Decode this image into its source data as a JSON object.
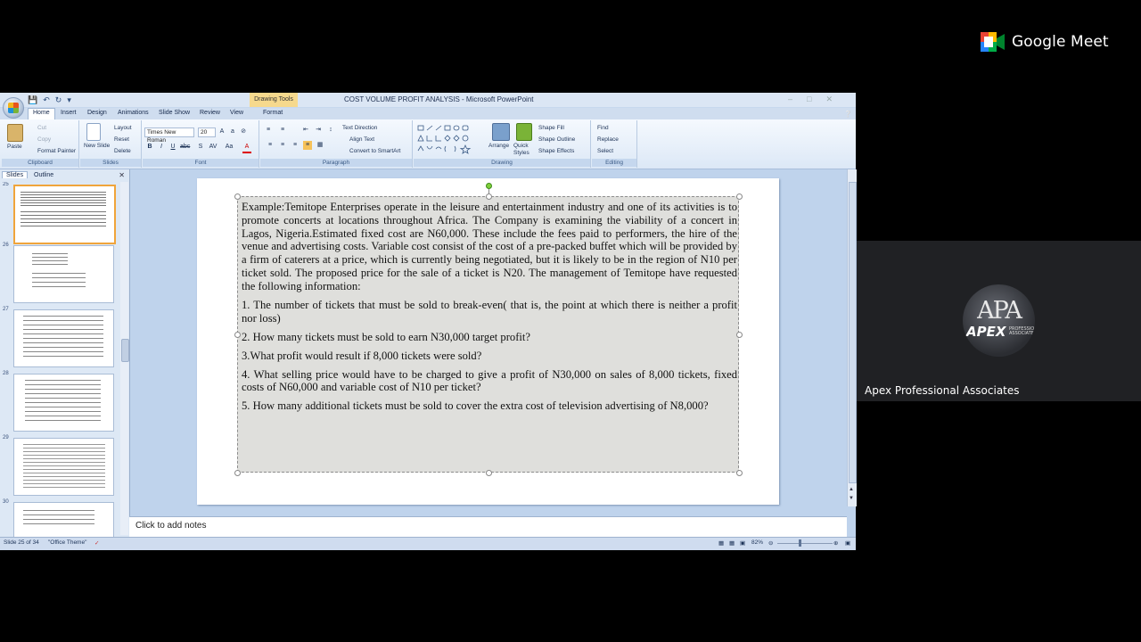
{
  "meet": {
    "brand": "Google Meet",
    "participant_name": "Apex Professional Associates",
    "avatar_initials": "APA",
    "avatar_word": "APEX",
    "avatar_sub": "PROFESSIONAL ASSOCIATES"
  },
  "ppt": {
    "window_title": "COST VOLUME PROFIT ANALYSIS - Microsoft PowerPoint",
    "context_tab": "Drawing Tools",
    "tabs": [
      "Home",
      "Insert",
      "Design",
      "Animations",
      "Slide Show",
      "Review",
      "View",
      "Format"
    ],
    "ribbon": {
      "clipboard": {
        "label": "Clipboard",
        "paste": "Paste",
        "cut": "Cut",
        "copy": "Copy",
        "format_painter": "Format Painter"
      },
      "slides": {
        "label": "Slides",
        "new_slide": "New Slide",
        "layout": "Layout",
        "reset": "Reset",
        "delete": "Delete"
      },
      "font": {
        "label": "Font",
        "family": "Times New Roman",
        "size": "20"
      },
      "paragraph": {
        "label": "Paragraph",
        "text_direction": "Text Direction",
        "align_text": "Align Text",
        "convert": "Convert to SmartArt"
      },
      "drawing": {
        "label": "Drawing",
        "arrange": "Arrange",
        "quick_styles": "Quick Styles",
        "shape_fill": "Shape Fill",
        "shape_outline": "Shape Outline",
        "shape_effects": "Shape Effects"
      },
      "editing": {
        "label": "Editing",
        "find": "Find",
        "replace": "Replace",
        "select": "Select"
      }
    },
    "panel_tabs": {
      "slides": "Slides",
      "outline": "Outline"
    },
    "thumb_numbers": [
      "25",
      "26",
      "27",
      "28",
      "29",
      "30"
    ],
    "slide_paragraphs": [
      "Example:Temitope Enterprises operate in the leisure and entertainment industry and one of its activities is to promote concerts at locations throughout Africa. The Company is examining the viability of a concert in Lagos, Nigeria.Estimated fixed cost are N60,000. These include the fees paid to performers, the hire of the venue and advertising costs. Variable cost consist of the cost of a pre-packed buffet which will be provided by a firm of caterers at a price, which is currently being negotiated, but it is likely to be in the region of N10 per ticket sold. The proposed price for the sale of a ticket is N20. The management of Temitope have requested the following information:",
      "1. The number of tickets that must be sold to break-even( that is, the point at which there is neither a profit nor loss)",
      "2. How many tickets must be sold to earn N30,000 target profit?",
      "3.What profit would result if 8,000 tickets were sold?",
      "4. What selling price would have to be charged to give a profit of N30,000 on sales of 8,000 tickets, fixed costs of N60,000 and variable cost of N10 per ticket?",
      "5. How many additional tickets must be sold to cover the extra cost of television advertising of N8,000?"
    ],
    "notes_placeholder": "Click to add notes",
    "status": {
      "slide_info": "Slide 25 of 34",
      "theme": "\"Office Theme\"",
      "zoom": "82%"
    }
  }
}
